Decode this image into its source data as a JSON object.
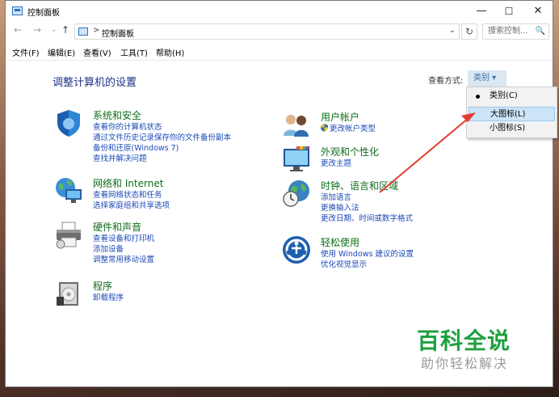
{
  "window": {
    "title": "控制面板"
  },
  "window_buttons": {
    "minimize": "—",
    "maximize": "☐",
    "close": "✕"
  },
  "nav": {
    "back": "←",
    "forward": "→",
    "dropdown": "⌄",
    "up": "↑"
  },
  "address": {
    "separator": ">",
    "path": "控制面板",
    "dropdown": "⌄",
    "refresh": "↻"
  },
  "search": {
    "placeholder": "搜索控制...",
    "icon": "🔍"
  },
  "menu": [
    "文件(F)",
    "编辑(E)",
    "查看(V)",
    "工具(T)",
    "帮助(H)"
  ],
  "heading": "调整计算机的设置",
  "view_by": {
    "label": "查看方式:",
    "value": "类别 ▾"
  },
  "categories": [
    {
      "title": "系统和安全",
      "links": [
        "查看你的计算机状态",
        "通过文件历史记录保存你的文件备份副本",
        "备份和还原(Windows 7)",
        "查找并解决问题"
      ]
    },
    {
      "title": "网络和 Internet",
      "links": [
        "查看网络状态和任务",
        "选择家庭组和共享选项"
      ]
    },
    {
      "title": "硬件和声音",
      "links": [
        "查看设备和打印机",
        "添加设备",
        "调整常用移动设置"
      ]
    },
    {
      "title": "程序",
      "links": [
        "卸载程序"
      ]
    },
    {
      "title": "用户帐户",
      "links": [
        "更改帐户类型"
      ]
    },
    {
      "title": "外观和个性化",
      "links": [
        "更改主题"
      ]
    },
    {
      "title": "时钟、语言和区域",
      "links": [
        "添加语言",
        "更换输入法",
        "更改日期、时间或数字格式"
      ]
    },
    {
      "title": "轻松使用",
      "links": [
        "使用 Windows 建议的设置",
        "优化视觉显示"
      ]
    }
  ],
  "dropdown_menu": [
    "类别(C)",
    "大图标(L)",
    "小图标(S)"
  ],
  "watermark": {
    "title": "百科全说",
    "subtitle": "助你轻松解决"
  },
  "colors": {
    "heading": "#1e3287",
    "category_title": "#0e6d1a",
    "link": "#1a48b8",
    "annotation_arrow": "#e53a2e",
    "watermark": "#1ea040"
  }
}
